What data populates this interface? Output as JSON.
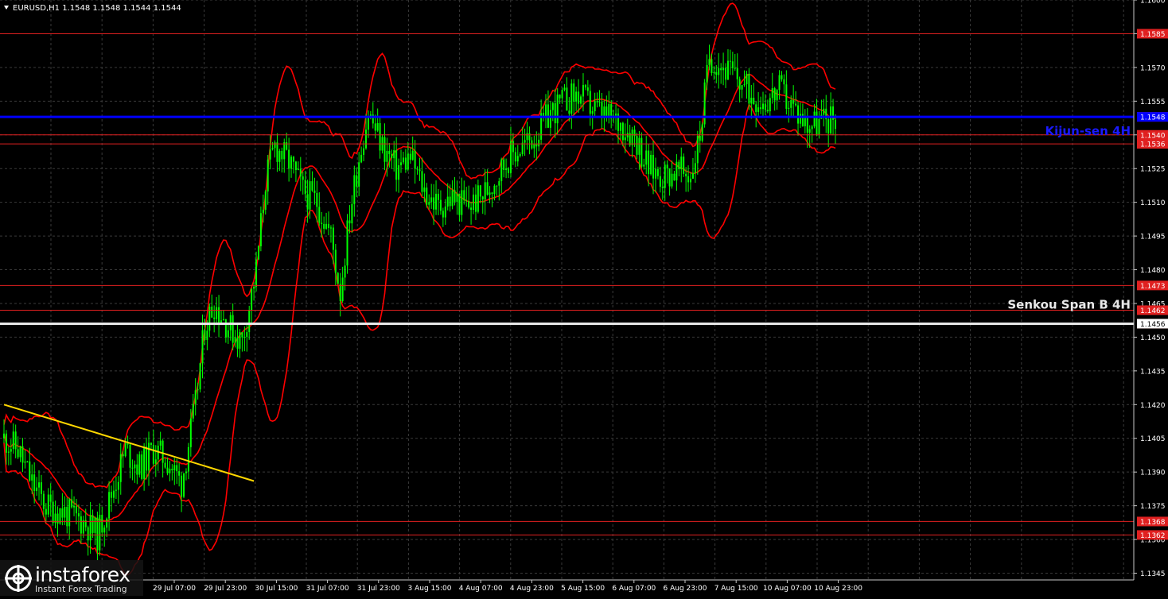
{
  "header": {
    "symbol_text": "EURUSD,H1  1.1548 1.1548 1.1544 1.1544"
  },
  "watermark": {
    "brand": "instaforex",
    "tagline": "Instant Forex Trading"
  },
  "colors": {
    "background": "#000000",
    "grid": "#3a3a3a",
    "candle": "#00ff00",
    "bollinger": "#ff0000",
    "level_line": "#e02020",
    "kijun_line": "#0000ff",
    "senkou_line": "#e8e8e8",
    "trend_line": "#ffd700",
    "axis_text": "#ffffff"
  },
  "chart_data": {
    "type": "candlestick",
    "title": "EURUSD,H1",
    "ylim": [
      1.1342,
      1.16
    ],
    "grid": true,
    "y_ticks": [
      "1.1600",
      "1.1585",
      "1.1570",
      "1.1555",
      "1.1540",
      "1.1525",
      "1.1510",
      "1.1495",
      "1.1480",
      "1.1465",
      "1.1450",
      "1.1435",
      "1.1420",
      "1.1405",
      "1.1390",
      "1.1375",
      "1.1360",
      "1.1345"
    ],
    "x_labels": [
      "29 Jul 07:00",
      "29 Jul 23:00",
      "30 Jul 15:00",
      "31 Jul 07:00",
      "31 Jul 23:00",
      "3 Aug 15:00",
      "4 Aug 07:00",
      "4 Aug 23:00",
      "5 Aug 15:00",
      "6 Aug 07:00",
      "6 Aug 23:00",
      "7 Aug 15:00",
      "10 Aug 07:00",
      "10 Aug 23:00"
    ],
    "levels": [
      {
        "value": 1.1585,
        "label": "1.1585"
      },
      {
        "value": 1.1548,
        "label": "1.1548"
      },
      {
        "value": 1.154,
        "label": "1.1540"
      },
      {
        "value": 1.1536,
        "label": "1.1536"
      },
      {
        "value": 1.1473,
        "label": "1.1473"
      },
      {
        "value": 1.1462,
        "label": "1.1462"
      },
      {
        "value": 1.1456,
        "label": "1.1456"
      },
      {
        "value": 1.1368,
        "label": "1.1368"
      },
      {
        "value": 1.1362,
        "label": "1.1362"
      }
    ],
    "kijun_sen": {
      "label": "Kijun-sen 4H",
      "value": 1.1548,
      "price_label": "1.1548"
    },
    "senkou_span_b": {
      "label": "Senkou Span B 4H",
      "value": 1.1456,
      "price_label": "1.1456"
    },
    "trend_line": {
      "from": {
        "bar": 0,
        "price": 1.142
      },
      "to": {
        "bar": 107,
        "price": 1.1386
      }
    },
    "price_path": [
      [
        0,
        1.1405
      ],
      [
        6,
        1.14
      ],
      [
        12,
        1.1385
      ],
      [
        18,
        1.1375
      ],
      [
        26,
        1.1372
      ],
      [
        34,
        1.1368
      ],
      [
        40,
        1.1362
      ],
      [
        46,
        1.138
      ],
      [
        52,
        1.14
      ],
      [
        58,
        1.1392
      ],
      [
        64,
        1.14
      ],
      [
        70,
        1.1395
      ],
      [
        76,
        1.1385
      ],
      [
        82,
        1.142
      ],
      [
        86,
        1.1455
      ],
      [
        90,
        1.1465
      ],
      [
        96,
        1.1455
      ],
      [
        102,
        1.1448
      ],
      [
        108,
        1.148
      ],
      [
        112,
        1.152
      ],
      [
        116,
        1.1535
      ],
      [
        122,
        1.1528
      ],
      [
        128,
        1.1515
      ],
      [
        134,
        1.151
      ],
      [
        140,
        1.1495
      ],
      [
        144,
        1.147
      ],
      [
        148,
        1.1505
      ],
      [
        152,
        1.153
      ],
      [
        156,
        1.155
      ],
      [
        162,
        1.1535
      ],
      [
        168,
        1.1525
      ],
      [
        174,
        1.153
      ],
      [
        180,
        1.1515
      ],
      [
        186,
        1.1508
      ],
      [
        192,
        1.1512
      ],
      [
        198,
        1.1508
      ],
      [
        204,
        1.1512
      ],
      [
        210,
        1.152
      ],
      [
        216,
        1.153
      ],
      [
        222,
        1.1535
      ],
      [
        228,
        1.154
      ],
      [
        234,
        1.155
      ],
      [
        240,
        1.1555
      ],
      [
        246,
        1.1558
      ],
      [
        252,
        1.1552
      ],
      [
        258,
        1.1548
      ],
      [
        264,
        1.1545
      ],
      [
        270,
        1.154
      ],
      [
        276,
        1.1525
      ],
      [
        282,
        1.1522
      ],
      [
        288,
        1.1524
      ],
      [
        294,
        1.1522
      ],
      [
        298,
        1.154
      ],
      [
        302,
        1.1575
      ],
      [
        308,
        1.157
      ],
      [
        314,
        1.1565
      ],
      [
        320,
        1.1558
      ],
      [
        326,
        1.1555
      ],
      [
        332,
        1.156
      ],
      [
        338,
        1.1552
      ],
      [
        344,
        1.1545
      ],
      [
        350,
        1.1546
      ],
      [
        356,
        1.1548
      ]
    ],
    "total_bars": 357
  }
}
